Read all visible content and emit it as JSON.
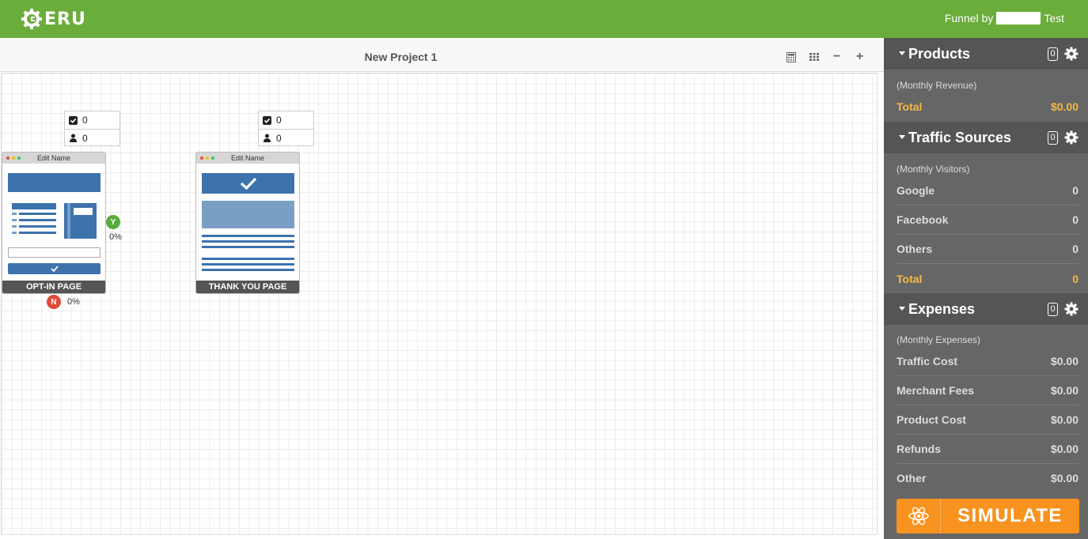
{
  "header": {
    "logo_text": "ERU",
    "user_prefix": "Funnel by",
    "user_suffix": "Test"
  },
  "canvas": {
    "project_title": "New Project 1",
    "tools": [
      "calculator-icon",
      "grid-icon",
      "zoom-out-icon",
      "zoom-in-icon"
    ],
    "zoom_out_label": "−",
    "zoom_in_label": "+"
  },
  "nodes": [
    {
      "name": "Edit Name",
      "label": "OPT-IN PAGE",
      "conversions": "0",
      "visitors": "0",
      "yes_badge": "Y",
      "yes_pct": "0%",
      "no_badge": "N",
      "no_pct": "0%"
    },
    {
      "name": "Edit Name",
      "label": "THANK YOU PAGE",
      "conversions": "0",
      "visitors": "0"
    }
  ],
  "sidebar": {
    "products": {
      "title": "Products",
      "count": "0",
      "subtitle": "(Monthly Revenue)",
      "total_label": "Total",
      "total_value": "$0.00"
    },
    "traffic": {
      "title": "Traffic Sources",
      "count": "0",
      "subtitle": "(Monthly Visitors)",
      "items": [
        {
          "label": "Google",
          "value": "0"
        },
        {
          "label": "Facebook",
          "value": "0"
        },
        {
          "label": "Others",
          "value": "0"
        }
      ],
      "total_label": "Total",
      "total_value": "0"
    },
    "expenses": {
      "title": "Expenses",
      "count": "0",
      "subtitle": "(Monthly Expenses)",
      "items": [
        {
          "label": "Traffic Cost",
          "value": "$0.00"
        },
        {
          "label": "Merchant Fees",
          "value": "$0.00"
        },
        {
          "label": "Product Cost",
          "value": "$0.00"
        },
        {
          "label": "Refunds",
          "value": "$0.00"
        },
        {
          "label": "Other",
          "value": "$0.00"
        }
      ]
    },
    "simulate_label": "SIMULATE"
  },
  "colors": {
    "brand_green": "#6aad3a",
    "sidebar_bg": "#666666",
    "accent_orange": "#f7931e",
    "total_yellow": "#f5b942",
    "block_blue": "#3d72ad",
    "yes_green": "#5aab3e",
    "no_red": "#e04b3a"
  }
}
